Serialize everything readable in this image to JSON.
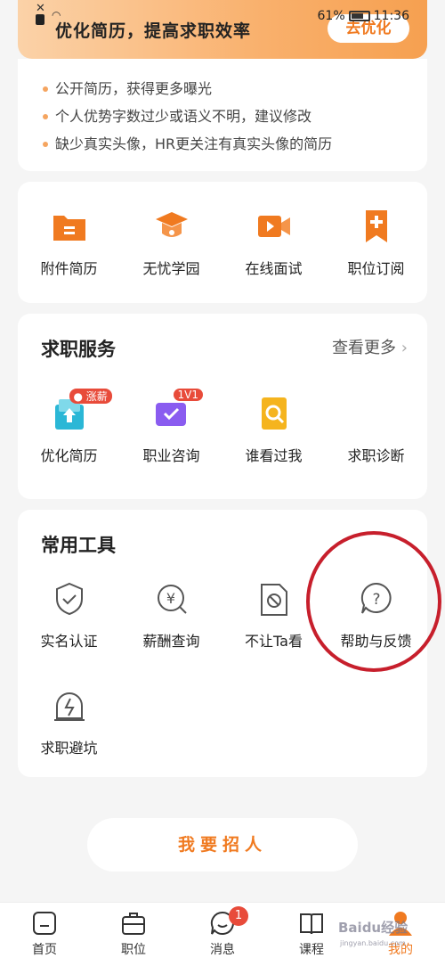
{
  "status": {
    "time": "11:36",
    "battery": "61%"
  },
  "banner": {
    "title": "优化简历，提高求职效率",
    "button": "去优化"
  },
  "tips": [
    "公开简历，获得更多曝光",
    "个人优势字数过少或语义不明，建议修改",
    "缺少真实头像，HR更关注有真实头像的简历"
  ],
  "quick": [
    {
      "label": "附件简历",
      "icon": "folder-icon"
    },
    {
      "label": "无忧学园",
      "icon": "graduation-cap-icon"
    },
    {
      "label": "在线面试",
      "icon": "video-icon"
    },
    {
      "label": "职位订阅",
      "icon": "bookmark-add-icon"
    }
  ],
  "services": {
    "title": "求职服务",
    "more": "查看更多",
    "items": [
      {
        "label": "优化简历",
        "badge": "涨薪",
        "icon": "upload-resume-icon"
      },
      {
        "label": "职业咨询",
        "badge": "1V1",
        "icon": "chat-check-icon"
      },
      {
        "label": "谁看过我",
        "icon": "doc-search-icon"
      },
      {
        "label": "求职诊断",
        "icon": ""
      }
    ]
  },
  "tools": {
    "title": "常用工具",
    "items": [
      {
        "label": "实名认证",
        "icon": "shield-check-icon"
      },
      {
        "label": "薪酬查询",
        "icon": "yen-search-icon"
      },
      {
        "label": "不让Ta看",
        "icon": "block-icon"
      },
      {
        "label": "帮助与反馈",
        "icon": "question-icon"
      },
      {
        "label": "求职避坑",
        "icon": "alert-lamp-icon"
      }
    ]
  },
  "recruit": "我要招人",
  "tabs": [
    {
      "label": "首页",
      "icon": "home-icon"
    },
    {
      "label": "职位",
      "icon": "briefcase-icon"
    },
    {
      "label": "消息",
      "icon": "message-icon",
      "badge": "1"
    },
    {
      "label": "课程",
      "icon": "book-icon"
    },
    {
      "label": "我的",
      "icon": "user-icon"
    }
  ],
  "watermark": "Baidu经验",
  "watermark_url": "jingyan.baidu.com",
  "colors": {
    "accent": "#f07a20",
    "annotation": "#c71f2c"
  }
}
